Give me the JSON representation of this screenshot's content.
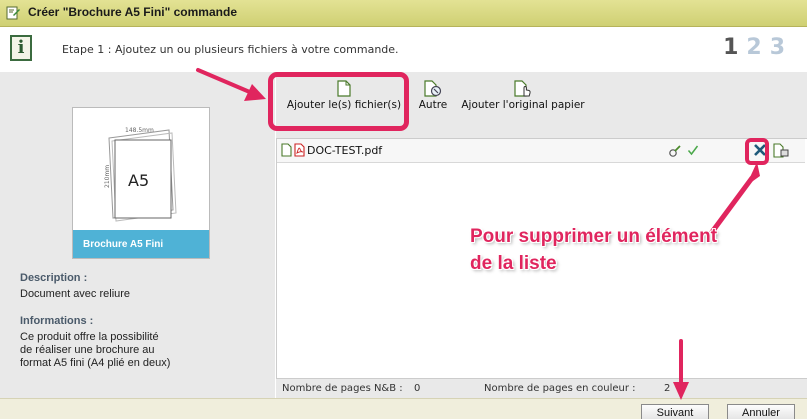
{
  "window": {
    "title": "Créer \"Brochure A5 Fini\" commande",
    "icon": "document-edit-icon"
  },
  "stepbar": {
    "text": "Etape 1 : Ajoutez un ou plusieurs fichiers à votre commande.",
    "steps": [
      "1",
      "2",
      "3"
    ],
    "active_step": "1"
  },
  "product": {
    "thumb_width_label": "148.5mm",
    "thumb_height_label": "210mm",
    "thumb_format": "A5",
    "caption": "Brochure A5 Fini",
    "description_label": "Description :",
    "description": "Document avec reliure",
    "info_label": "Informations :",
    "info_lines": [
      "Ce produit offre la possibilité",
      "de réaliser une brochure au",
      "format A5 fini (A4 plié en deux)"
    ]
  },
  "toolbar": {
    "add_files": "Ajouter le(s) fichier(s)",
    "other": "Autre",
    "add_paper": "Ajouter l'original papier"
  },
  "files": [
    {
      "name": "DOC-TEST.pdf",
      "type_icon": "pdf-icon"
    }
  ],
  "status": {
    "bw_pages_label": "Nombre de pages N&B :",
    "bw_pages": "0",
    "color_pages_label": "Nombre de pages en couleur :",
    "color_pages": "2"
  },
  "footer": {
    "next": "Suivant",
    "cancel": "Annuler"
  },
  "annotation": {
    "line1": "Pour supprimer un élément",
    "line2": "de la liste"
  },
  "colors": {
    "titlebar": "#d8d87f",
    "highlight": "#e0255e",
    "caption_bg": "#4fb2d6",
    "panel_bg": "#e9e9e9"
  }
}
